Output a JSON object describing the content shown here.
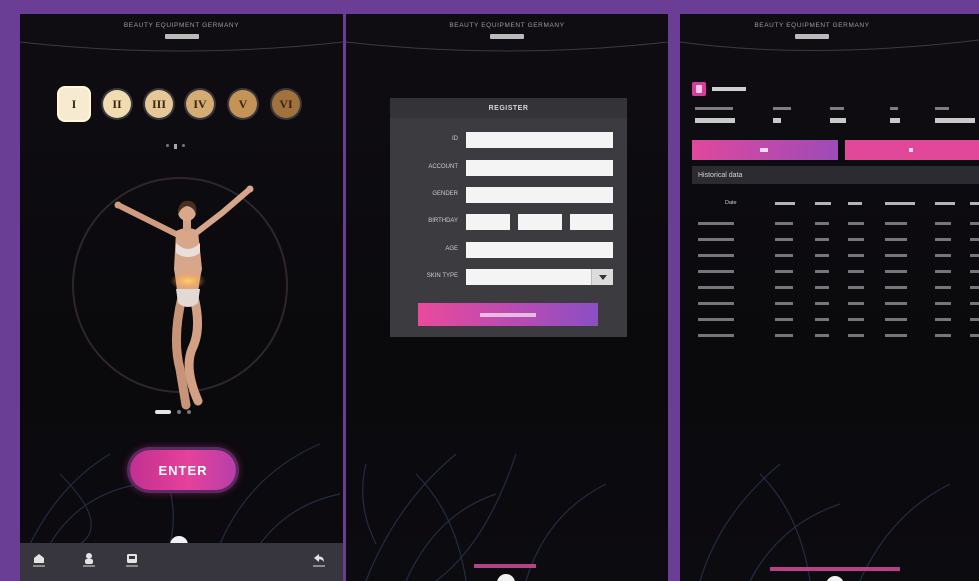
{
  "app": {
    "brand": "BEAUTY EQUIPMENT GERMANY"
  },
  "home": {
    "skin_types": [
      "I",
      "II",
      "III",
      "IV",
      "V",
      "VI"
    ],
    "skin_colors": [
      "#f6ead0",
      "#f1dbb0",
      "#e6c898",
      "#d5ac74",
      "#c49356",
      "#a2723c"
    ],
    "enter_label": "ENTER"
  },
  "register": {
    "title": "REGISTER",
    "fields": {
      "id": "ID",
      "account": "ACCOUNT",
      "gender": "GENDER",
      "birthday": "BIRTHDAY",
      "age": "AGE",
      "skin_type": "SKIN TYPE"
    }
  },
  "history": {
    "section_title": "Historical data",
    "table_headers": [
      "Date"
    ]
  },
  "nav": {
    "icons": [
      "home-icon",
      "user-icon",
      "device-icon",
      "back-icon"
    ]
  },
  "colors": {
    "background": "#6b3e96",
    "screen": "#0c0b0f",
    "accent_pink": "#e6419b",
    "accent_purple": "#8a4fc4",
    "form_panel": "#3b3b40"
  }
}
